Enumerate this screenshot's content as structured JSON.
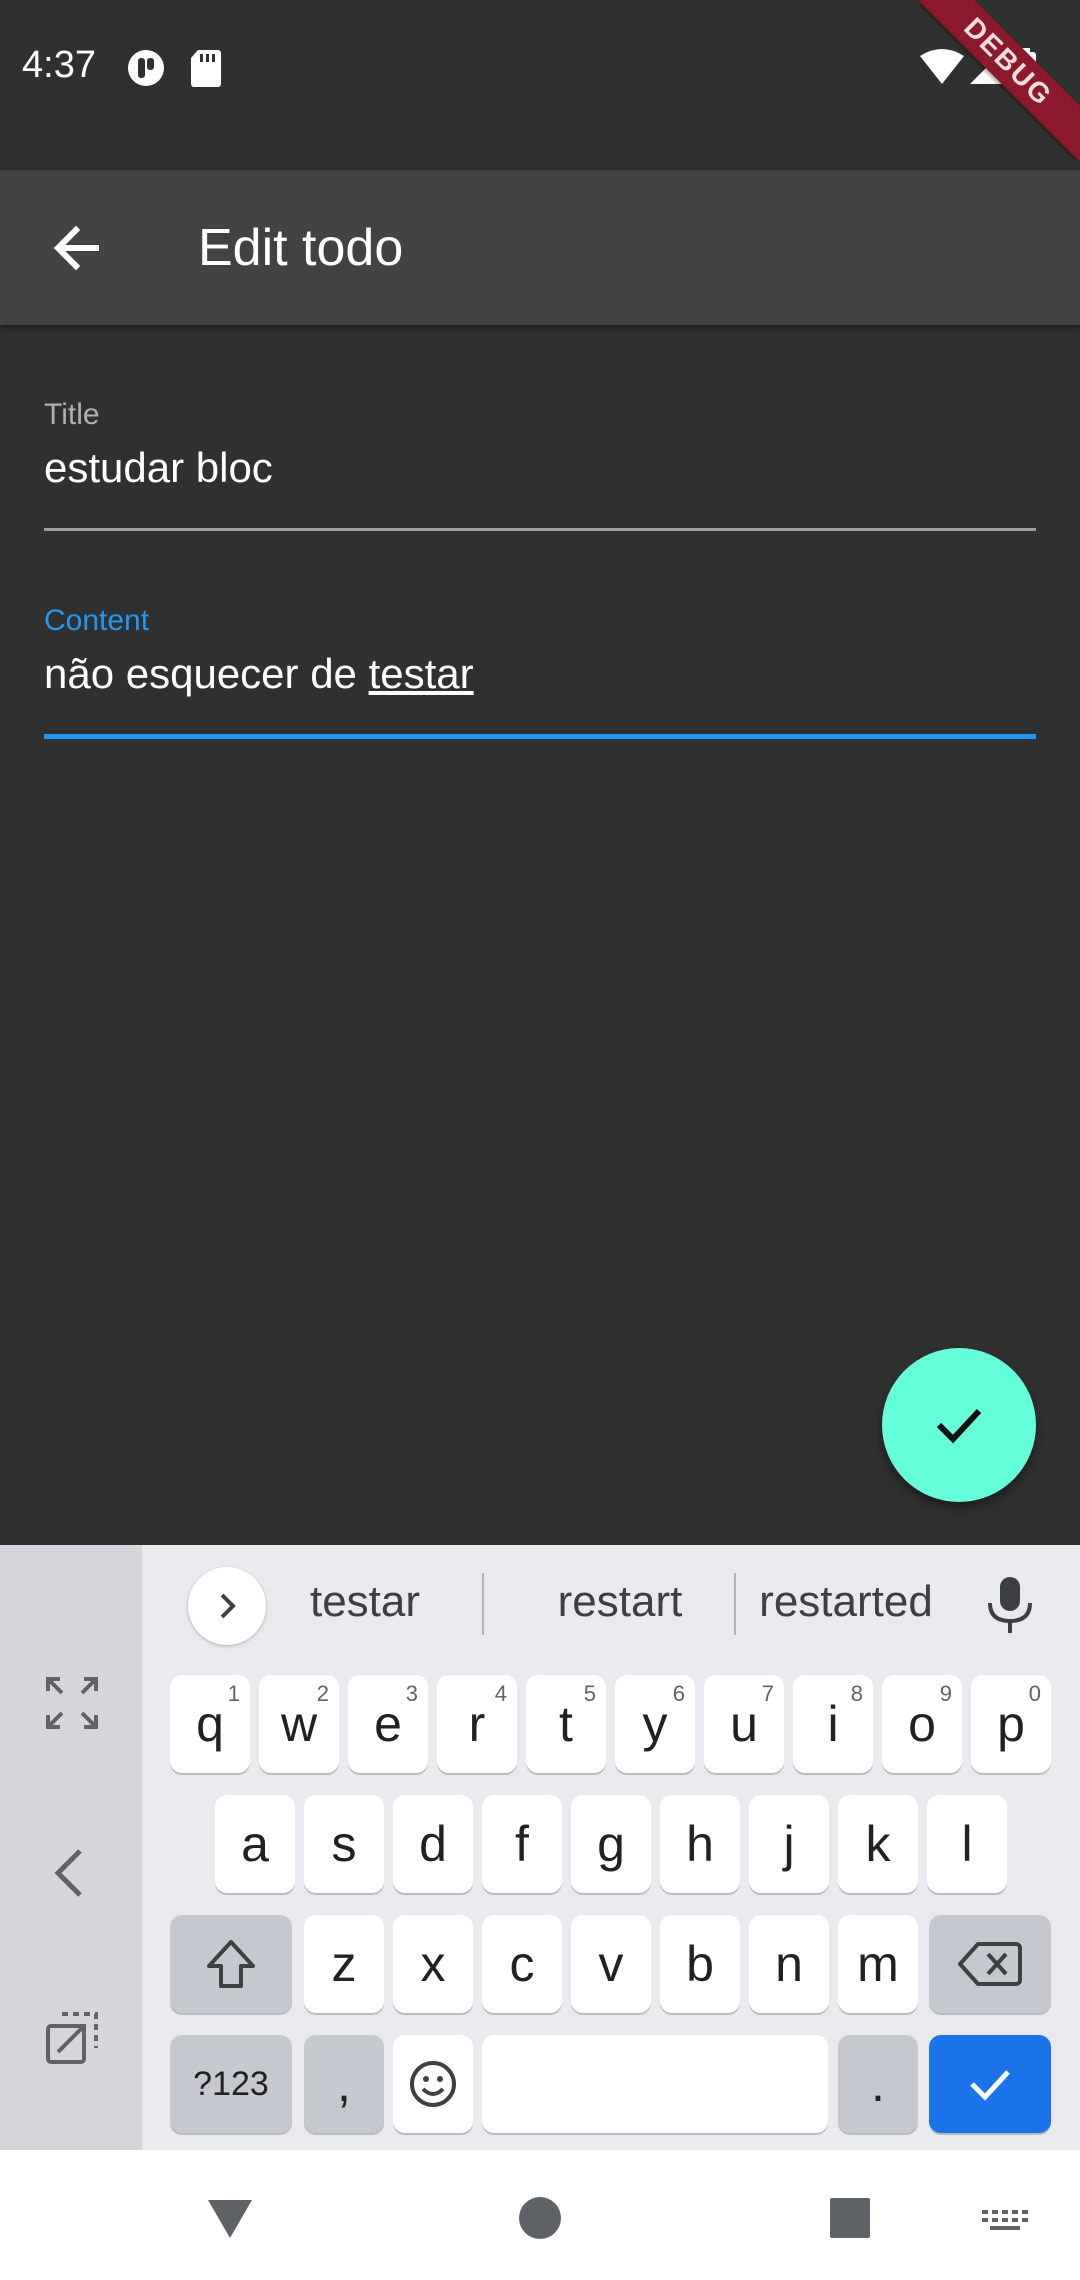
{
  "status_bar": {
    "time": "4:37",
    "debug_banner": "DEBUG"
  },
  "app_bar": {
    "title": "Edit todo"
  },
  "form": {
    "title_field": {
      "label": "Title",
      "value": "estudar bloc"
    },
    "content_field": {
      "label": "Content",
      "value_plain": "não esquecer de ",
      "value_composing": "testar"
    }
  },
  "fab": {
    "icon": "check-icon",
    "color": "#64ffda"
  },
  "keyboard": {
    "suggestions": [
      "testar",
      "restart",
      "restarted"
    ],
    "row1": [
      {
        "key": "q",
        "hint": "1"
      },
      {
        "key": "w",
        "hint": "2"
      },
      {
        "key": "e",
        "hint": "3"
      },
      {
        "key": "r",
        "hint": "4"
      },
      {
        "key": "t",
        "hint": "5"
      },
      {
        "key": "y",
        "hint": "6"
      },
      {
        "key": "u",
        "hint": "7"
      },
      {
        "key": "i",
        "hint": "8"
      },
      {
        "key": "o",
        "hint": "9"
      },
      {
        "key": "p",
        "hint": "0"
      }
    ],
    "row2": [
      "a",
      "s",
      "d",
      "f",
      "g",
      "h",
      "j",
      "k",
      "l"
    ],
    "row3": [
      "z",
      "x",
      "c",
      "v",
      "b",
      "n",
      "m"
    ],
    "symbols_label": "?123",
    "comma_label": ",",
    "period_label": ".",
    "action_color": "#1a73e8"
  },
  "colors": {
    "accent": "#2196f3",
    "background": "#303030",
    "app_bar": "#424242"
  }
}
